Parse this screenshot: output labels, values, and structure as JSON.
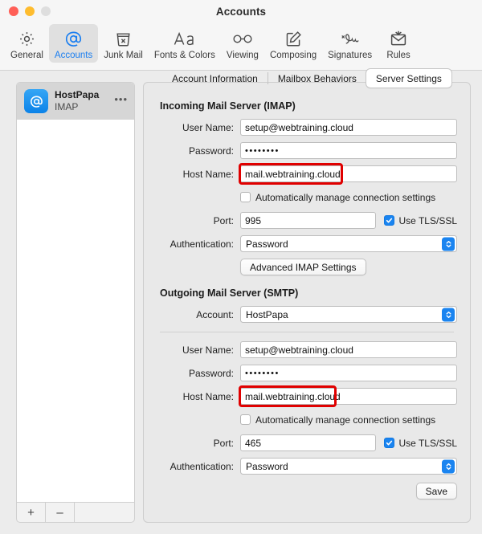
{
  "window": {
    "title": "Accounts",
    "traffic_lights": [
      "close",
      "minimize",
      "zoom"
    ]
  },
  "toolbar": {
    "items": [
      {
        "label": "General",
        "icon": "gear-icon",
        "selected": false
      },
      {
        "label": "Accounts",
        "icon": "at-sign-icon",
        "selected": true
      },
      {
        "label": "Junk Mail",
        "icon": "trash-x-icon",
        "selected": false
      },
      {
        "label": "Fonts & Colors",
        "icon": "font-aa-icon",
        "selected": false
      },
      {
        "label": "Viewing",
        "icon": "glasses-icon",
        "selected": false
      },
      {
        "label": "Composing",
        "icon": "compose-pencil-icon",
        "selected": false
      },
      {
        "label": "Signatures",
        "icon": "signature-icon",
        "selected": false
      },
      {
        "label": "Rules",
        "icon": "rules-envelope-icon",
        "selected": false
      }
    ]
  },
  "sidebar": {
    "accounts": [
      {
        "name": "HostPapa",
        "type": "IMAP",
        "badge": "@",
        "more": "•••",
        "selected": true
      }
    ],
    "add_label": "+",
    "remove_label": "–"
  },
  "tabs": [
    {
      "label": "Account Information",
      "selected": false
    },
    {
      "label": "Mailbox Behaviors",
      "selected": false
    },
    {
      "label": "Server Settings",
      "selected": true
    }
  ],
  "incoming": {
    "heading": "Incoming Mail Server (IMAP)",
    "user_name_label": "User Name:",
    "user_name_value": "setup@webtraining.cloud",
    "password_label": "Password:",
    "password_value": "••••••••",
    "host_name_label": "Host Name:",
    "host_name_value": "mail.webtraining.cloud",
    "auto_manage_label": "Automatically manage connection settings",
    "auto_manage_checked": false,
    "port_label": "Port:",
    "port_value": "995",
    "tls_label": "Use TLS/SSL",
    "tls_checked": true,
    "auth_label": "Authentication:",
    "auth_value": "Password",
    "advanced_button": "Advanced IMAP Settings"
  },
  "outgoing": {
    "heading": "Outgoing Mail Server (SMTP)",
    "account_label": "Account:",
    "account_value": "HostPapa",
    "user_name_label": "User Name:",
    "user_name_value": "setup@webtraining.cloud",
    "password_label": "Password:",
    "password_value": "••••••••",
    "host_name_label": "Host Name:",
    "host_name_value": "mail.webtraining.cloud",
    "auto_manage_label": "Automatically manage connection settings",
    "auto_manage_checked": false,
    "port_label": "Port:",
    "port_value": "465",
    "tls_label": "Use TLS/SSL",
    "tls_checked": true,
    "auth_label": "Authentication:",
    "auth_value": "Password",
    "save_button": "Save"
  },
  "annotations": {
    "highlight_color": "#e00000",
    "boxes": [
      "incoming-host-name",
      "outgoing-host-name"
    ]
  },
  "colors": {
    "accent": "#1a84f0",
    "selected_tab_bg": "#ffffff",
    "window_bg": "#ececec"
  }
}
